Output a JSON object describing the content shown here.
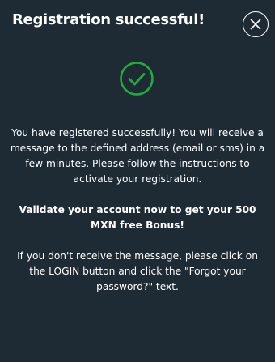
{
  "modal": {
    "title": "Registration successful!",
    "close_icon": "close-icon",
    "success_icon": "check-circle-icon",
    "accent_color": "#1fae3a",
    "background_color": "#1e2b35",
    "message_1": "You have registered successfully! You will receive a message to the defined address (email or sms) in a few minutes. Please follow the instructions to activate your registration.",
    "message_2": "Validate your account now to get your 500 MXN free Bonus!",
    "message_3": "If you don't receive the message, please click on the LOGIN button and click the \"Forgot your password?\" text."
  }
}
